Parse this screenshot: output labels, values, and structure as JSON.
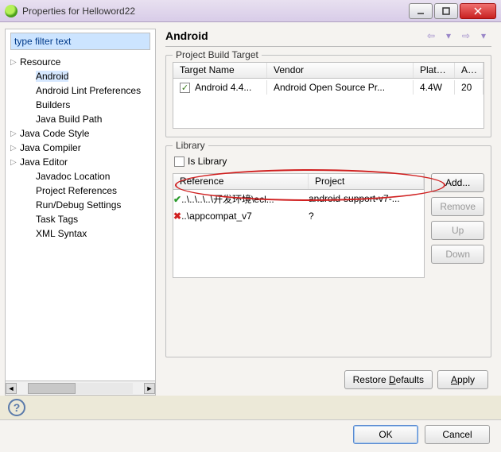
{
  "window": {
    "title": "Properties for Helloword22",
    "min": "",
    "max": "",
    "close": ""
  },
  "sidebar": {
    "filter_placeholder": "type filter text",
    "filter_value": "type filter text",
    "items": [
      {
        "label": "Resource",
        "expandable": true
      },
      {
        "label": "Android",
        "expandable": false,
        "selected": true,
        "child": true
      },
      {
        "label": "Android Lint Preferences",
        "expandable": false,
        "child": true
      },
      {
        "label": "Builders",
        "expandable": false,
        "child": true
      },
      {
        "label": "Java Build Path",
        "expandable": false,
        "child": true
      },
      {
        "label": "Java Code Style",
        "expandable": true
      },
      {
        "label": "Java Compiler",
        "expandable": true
      },
      {
        "label": "Java Editor",
        "expandable": true
      },
      {
        "label": "Javadoc Location",
        "expandable": false,
        "child": true
      },
      {
        "label": "Project References",
        "expandable": false,
        "child": true
      },
      {
        "label": "Run/Debug Settings",
        "expandable": false,
        "child": true
      },
      {
        "label": "Task Tags",
        "expandable": false,
        "child": true
      },
      {
        "label": "XML Syntax",
        "expandable": false,
        "child": true
      }
    ]
  },
  "main": {
    "heading": "Android",
    "build_target": {
      "group_title": "Project Build Target",
      "headers": {
        "target": "Target Name",
        "vendor": "Vendor",
        "platfo": "Platfo...",
        "ap": "AP..."
      },
      "row": {
        "target": "Android 4.4...",
        "vendor": "Android Open Source Pr...",
        "platfo": "4.4W",
        "ap": "20"
      }
    },
    "library": {
      "group_title": "Library",
      "is_library_label": "Is Library",
      "headers": {
        "ref": "Reference",
        "proj": "Project"
      },
      "rows": [
        {
          "ok": true,
          "ref": "..\\..\\..\\..\\开发环境\\ecl...",
          "proj": "android-support-v7-..."
        },
        {
          "ok": false,
          "ref": "..\\appcompat_v7",
          "proj": "?"
        }
      ],
      "buttons": {
        "add": "Add...",
        "remove": "Remove",
        "up": "Up",
        "down": "Down"
      }
    },
    "defaults_btn": "Restore Defaults",
    "apply_btn": "Apply"
  },
  "dialog": {
    "ok": "OK",
    "cancel": "Cancel",
    "help": "?"
  }
}
